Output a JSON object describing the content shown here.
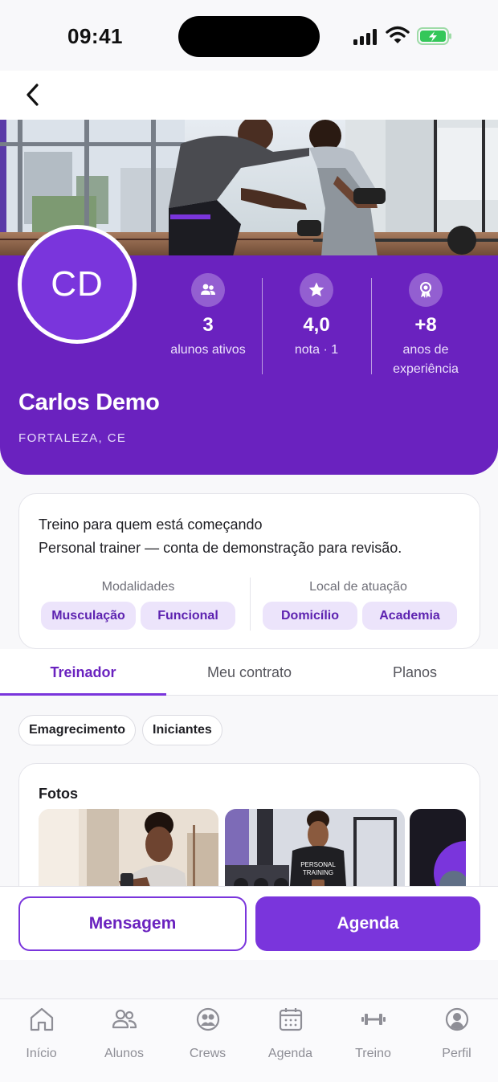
{
  "status_bar": {
    "time": "09:41"
  },
  "profile": {
    "initials": "CD",
    "name": "Carlos Demo",
    "location": "FORTALEZA, CE",
    "stats": [
      {
        "icon": "users-icon",
        "value": "3",
        "label_line1": "alunos ativos",
        "label_line2": ""
      },
      {
        "icon": "star-icon",
        "value": "4,0",
        "label_line1": "nota · 1",
        "label_line2": ""
      },
      {
        "icon": "award-icon",
        "value": "+8",
        "label_line1": "anos de",
        "label_line2": "experiência"
      }
    ]
  },
  "bio": {
    "title": "Treino para quem está começando",
    "subtitle": "Personal trainer — conta de demonstração para revisão.",
    "modalities_label": "Modalidades",
    "modalities": [
      "Musculação",
      "Funcional"
    ],
    "location_label": "Local de atuação",
    "locations": [
      "Domicílio",
      "Academia"
    ]
  },
  "tabs": [
    "Treinador",
    "Meu contrato",
    "Planos"
  ],
  "active_tab": "Treinador",
  "specialties": [
    "Emagrecimento",
    "Iniciantes"
  ],
  "photos": {
    "title": "Fotos"
  },
  "actions": {
    "message": "Mensagem",
    "schedule": "Agenda"
  },
  "bottom_nav": [
    {
      "label": "Início",
      "icon": "home-icon"
    },
    {
      "label": "Alunos",
      "icon": "students-icon"
    },
    {
      "label": "Crews",
      "icon": "crews-icon"
    },
    {
      "label": "Agenda",
      "icon": "calendar-icon"
    },
    {
      "label": "Treino",
      "icon": "dumbbell-icon"
    },
    {
      "label": "Perfil",
      "icon": "profile-icon"
    }
  ],
  "colors": {
    "primary": "#7a35dc",
    "header": "#6a22bf",
    "chip_bg": "#ece4fb",
    "battery": "#34c759"
  }
}
